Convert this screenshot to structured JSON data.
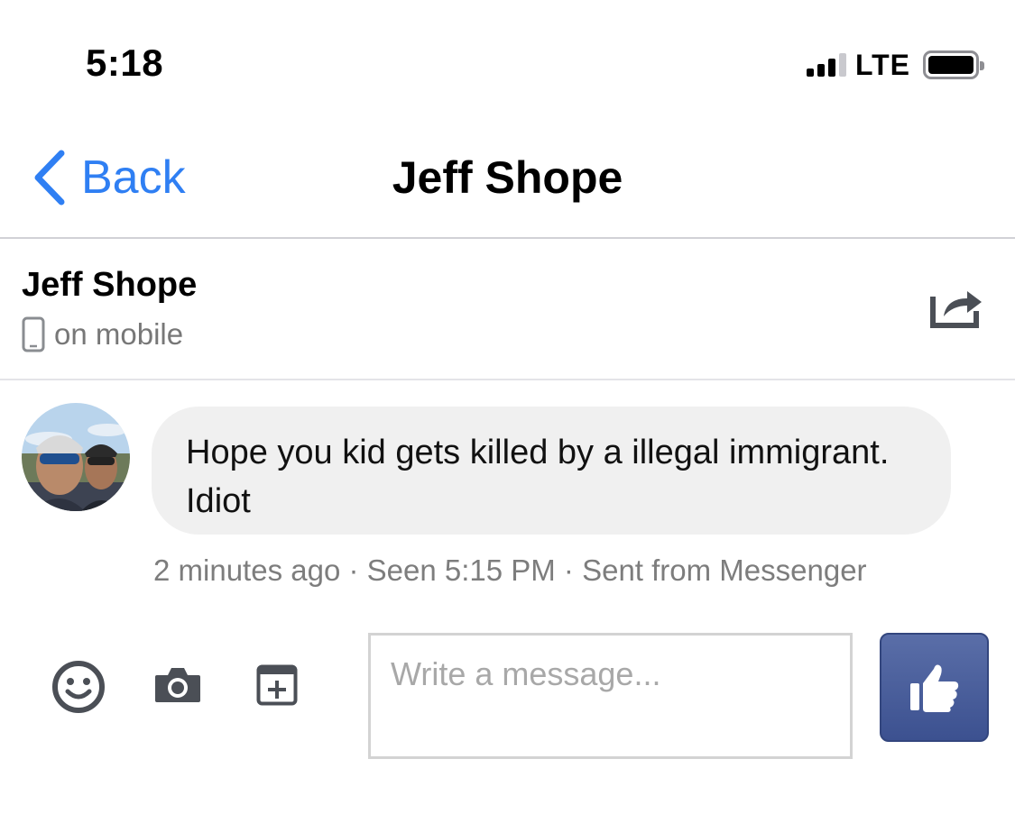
{
  "status_bar": {
    "time": "5:18",
    "network": "LTE",
    "signal_bars": 3,
    "signal_total": 4
  },
  "nav": {
    "back_label": "Back",
    "title": "Jeff Shope"
  },
  "thread": {
    "contact_name": "Jeff Shope",
    "presence": "on mobile"
  },
  "message": {
    "text": "Hope you kid gets killed by a illegal immigrant. Idiot",
    "meta": "2 minutes ago · Seen 5:15 PM · Sent from Messenger"
  },
  "composer": {
    "placeholder": "Write a message..."
  },
  "colors": {
    "ios_blue": "#2f7ff3",
    "bubble": "#f0f0f0",
    "like_button": "#4a5f9d",
    "icon_gray": "#4b4f56"
  },
  "icons": {
    "back": "chevron-left-icon",
    "presence": "mobile-phone-icon",
    "share": "share-icon",
    "emoji": "smiley-icon",
    "camera": "camera-icon",
    "attach": "add-file-icon",
    "like": "thumbs-up-icon"
  }
}
